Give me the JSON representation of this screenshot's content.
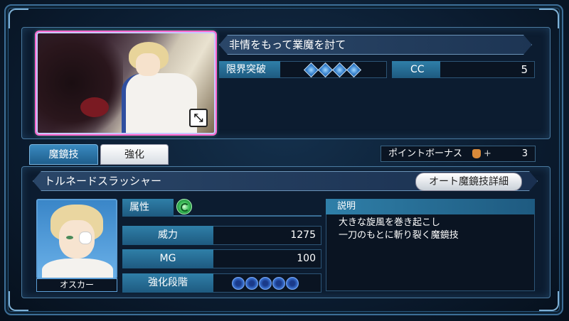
{
  "card": {
    "title": "非情をもって業魔を討て",
    "limit_break_label": "限界突破",
    "limit_break_level": 4,
    "cc_label": "CC",
    "cc_value": "5"
  },
  "tabs": [
    {
      "label": "魔鏡技",
      "active": true
    },
    {
      "label": "強化",
      "active": false
    }
  ],
  "point_bonus": {
    "label": "ポイントボーナス",
    "plus": "+",
    "value": "3",
    "icon": "bag-icon"
  },
  "skill": {
    "name": "トルネードスラッシャー",
    "detail_button": "オート魔鏡技詳細",
    "character_name": "オスカー",
    "attribute_label": "属性",
    "attribute_icon": "wind-icon",
    "power_label": "威力",
    "power_value": "1275",
    "mg_label": "MG",
    "mg_value": "100",
    "enhance_label": "強化段階",
    "enhance_level": 0,
    "enhance_max": 5,
    "description_header": "説明",
    "description": "大きな旋風を巻き起こし\n一刀のもとに斬り裂く魔鏡技"
  },
  "colors": {
    "accent": "#2f7fa8",
    "frame": "#4a7aa0"
  }
}
